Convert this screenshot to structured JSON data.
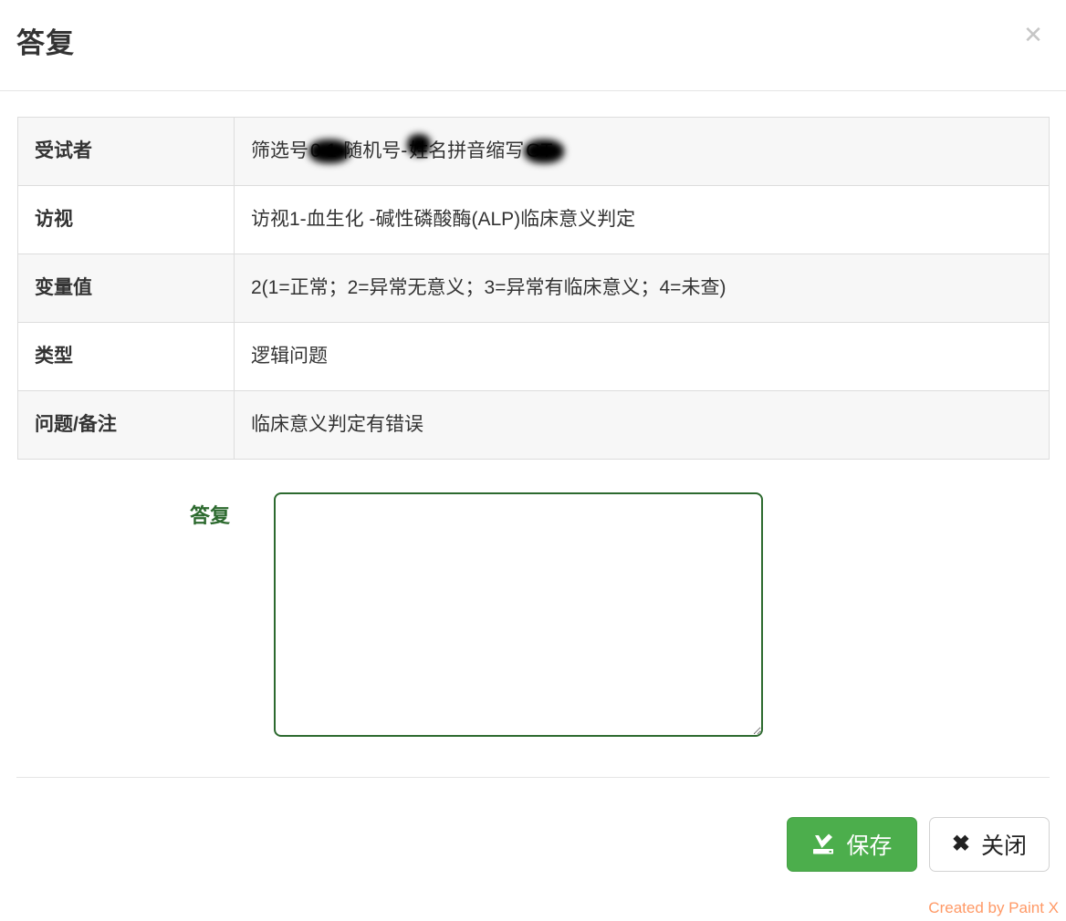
{
  "modal": {
    "title": "答复",
    "close_icon": "close-icon",
    "close_symbol": "✕"
  },
  "info_table": {
    "rows": [
      {
        "label": "受试者",
        "value_prefix": "筛选号",
        "value_mid": "-随机号-",
        "value_mid2": "姓名拼音缩写",
        "value_suffix": "GT",
        "full_value": "筛选号0▮1-随机号-姓名拼音缩写▮▮GT",
        "redacted": true
      },
      {
        "label": "访视",
        "full_value": "访视1-血生化 -碱性磷酸酶(ALP)临床意义判定",
        "redacted": false
      },
      {
        "label": "变量值",
        "full_value": "2(1=正常；2=异常无意义；3=异常有临床意义；4=未查)",
        "redacted": false
      },
      {
        "label": "类型",
        "full_value": "逻辑问题",
        "redacted": false
      },
      {
        "label": "问题/备注",
        "full_value": "临床意义判定有错误",
        "redacted": false
      }
    ]
  },
  "reply": {
    "label": "答复",
    "value": "",
    "placeholder": ""
  },
  "footer": {
    "save_label": "保存",
    "save_icon": "save-icon",
    "close_label": "关闭",
    "close_icon": "x-mark-icon",
    "close_symbol": "✖"
  },
  "watermark": {
    "text": "Created by Paint X"
  },
  "colors": {
    "accent_green": "#4cae4c",
    "border_green": "#2d6a2f",
    "divider": "#e5e5e5",
    "table_border": "#dddddd",
    "row_alt_bg": "#f7f7f7",
    "watermark": "#ff9966",
    "close_icon": "#c6c6c6"
  }
}
